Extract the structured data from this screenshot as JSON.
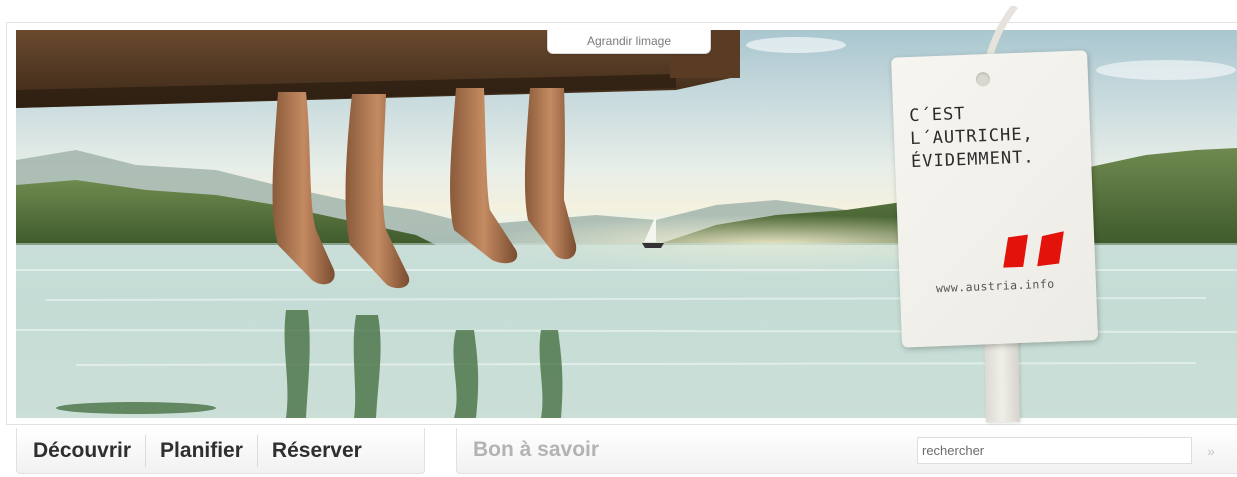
{
  "hero": {
    "enlarge_label": "Agrandir limage"
  },
  "tag": {
    "slogan": "C´EST\nL´AUTRICHE,\nÉVIDEMMENT.",
    "url": "www.austria.info"
  },
  "nav": {
    "items": [
      {
        "label": "Découvrir"
      },
      {
        "label": "Planifier"
      },
      {
        "label": "Réserver"
      }
    ]
  },
  "info": {
    "label": "Bon à savoir"
  },
  "search": {
    "placeholder": "rechercher",
    "button_icon": "double-chevron-right-icon"
  },
  "colors": {
    "brand_red": "#e3120b",
    "nav_text": "#2f2f2f",
    "muted_text": "#b3b3b3"
  }
}
